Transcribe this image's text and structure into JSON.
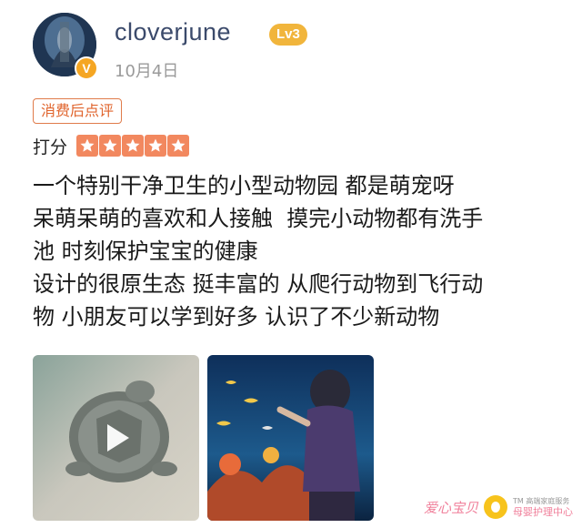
{
  "user": {
    "username": "cloverjune",
    "level": "Lv3",
    "verified_badge": "V",
    "date": "10月4日"
  },
  "review": {
    "tag": "消费后点评",
    "rating_label": "打分",
    "rating": 5,
    "rating_max": 5,
    "lines": [
      "一个特别干净卫生的小型动物园 都是萌宠呀",
      "呆萌呆萌的喜欢和人接触  摸完小动物都有洗手",
      "池 时刻保护宝宝的健康",
      "设计的很原生态 挺丰富的 从爬行动物到飞行动",
      "物 小朋友可以学到好多 认识了不少新动物"
    ]
  },
  "media": [
    {
      "type": "video",
      "icon": "play-icon"
    },
    {
      "type": "image"
    }
  ],
  "watermark": {
    "brand": "爱心宝贝",
    "tm_line": "TM 高端家庭服务",
    "sub": "母婴护理中心"
  },
  "colors": {
    "username": "#3b4a6b",
    "level_badge": "#f1b53c",
    "tag": "#e0642c",
    "star": "#f2885f"
  }
}
